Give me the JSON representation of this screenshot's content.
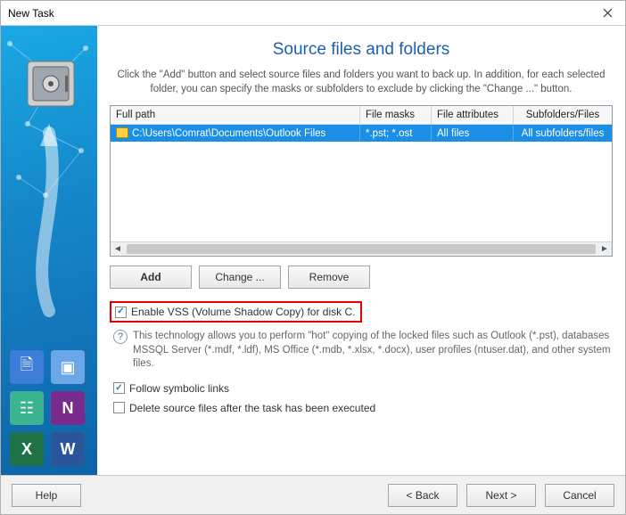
{
  "window": {
    "title": "New Task"
  },
  "page": {
    "title": "Source files and folders",
    "description": "Click the \"Add\" button and select source files and folders you want to back up. In addition, for each selected folder, you can specify the masks or subfolders to exclude by clicking the \"Change ...\" button."
  },
  "table": {
    "headers": {
      "full_path": "Full path",
      "file_masks": "File masks",
      "file_attributes": "File attributes",
      "subfolders": "Subfolders/Files"
    },
    "rows": [
      {
        "path": "C:\\Users\\Comrat\\Documents\\Outlook Files",
        "masks": "*.pst; *.ost",
        "attributes": "All files",
        "subfolders": "All subfolders/files"
      }
    ]
  },
  "buttons": {
    "add": "Add",
    "change": "Change ...",
    "remove": "Remove"
  },
  "options": {
    "enable_vss": "Enable VSS (Volume Shadow Copy) for disk C.",
    "vss_info": "This technology allows you to perform \"hot\" copying of the locked files such as Outlook (*.pst), databases MSSQL Server (*.mdf, *.ldf), MS Office (*.mdb, *.xlsx, *.docx), user profiles (ntuser.dat), and other system files.",
    "follow_links": "Follow symbolic links",
    "delete_after": "Delete source files after the task has been executed"
  },
  "footer": {
    "help": "Help",
    "back": "< Back",
    "next": "Next >",
    "cancel": "Cancel"
  }
}
